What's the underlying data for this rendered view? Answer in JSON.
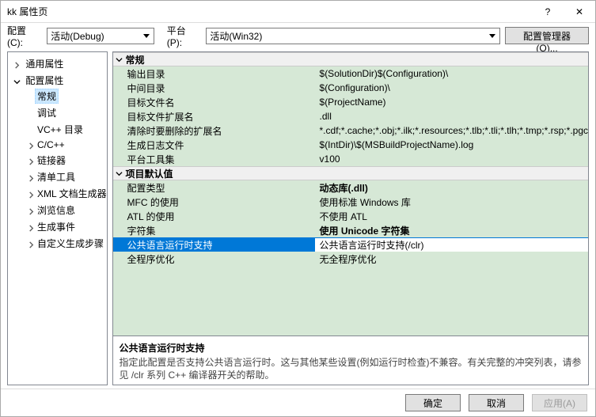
{
  "window": {
    "title": "kk 属性页",
    "help": "?",
    "close": "✕"
  },
  "toolbar": {
    "config_label": "配置(C):",
    "config_value": "活动(Debug)",
    "platform_label": "平台(P):",
    "platform_value": "活动(Win32)",
    "manager_btn": "配置管理器(O)..."
  },
  "tree": {
    "n0": "通用属性",
    "n1": "配置属性",
    "n1_0": "常规",
    "n1_1": "调试",
    "n1_2": "VC++ 目录",
    "n1_3": "C/C++",
    "n1_4": "链接器",
    "n1_5": "清单工具",
    "n1_6": "XML 文档生成器",
    "n1_7": "浏览信息",
    "n1_8": "生成事件",
    "n1_9": "自定义生成步骤"
  },
  "grid": {
    "group_general": "常规",
    "group_defaults": "项目默认值",
    "rows": {
      "out_dir_k": "输出目录",
      "out_dir_v": "$(SolutionDir)$(Configuration)\\",
      "int_dir_k": "中间目录",
      "int_dir_v": "$(Configuration)\\",
      "target_name_k": "目标文件名",
      "target_name_v": "$(ProjectName)",
      "target_ext_k": "目标文件扩展名",
      "target_ext_v": ".dll",
      "clean_ext_k": "清除时要删除的扩展名",
      "clean_ext_v": "*.cdf;*.cache;*.obj;*.ilk;*.resources;*.tlb;*.tli;*.tlh;*.tmp;*.rsp;*.pgc",
      "log_k": "生成日志文件",
      "log_v": "$(IntDir)\\$(MSBuildProjectName).log",
      "toolset_k": "平台工具集",
      "toolset_v": "v100",
      "conf_type_k": "配置类型",
      "conf_type_v": "动态库(.dll)",
      "mfc_k": "MFC 的使用",
      "mfc_v": "使用标准 Windows 库",
      "atl_k": "ATL 的使用",
      "atl_v": "不使用 ATL",
      "charset_k": "字符集",
      "charset_v": "使用 Unicode 字符集",
      "clr_k": "公共语言运行时支持",
      "clr_v": "公共语言运行时支持(/clr)",
      "wpo_k": "全程序优化",
      "wpo_v": "无全程序优化"
    }
  },
  "description": {
    "title": "公共语言运行时支持",
    "text": "指定此配置是否支持公共语言运行时。这与其他某些设置(例如运行时检查)不兼容。有关完整的冲突列表，请参见 /clr 系列 C++ 编译器开关的帮助。"
  },
  "footer": {
    "ok": "确定",
    "cancel": "取消",
    "apply": "应用(A)"
  }
}
